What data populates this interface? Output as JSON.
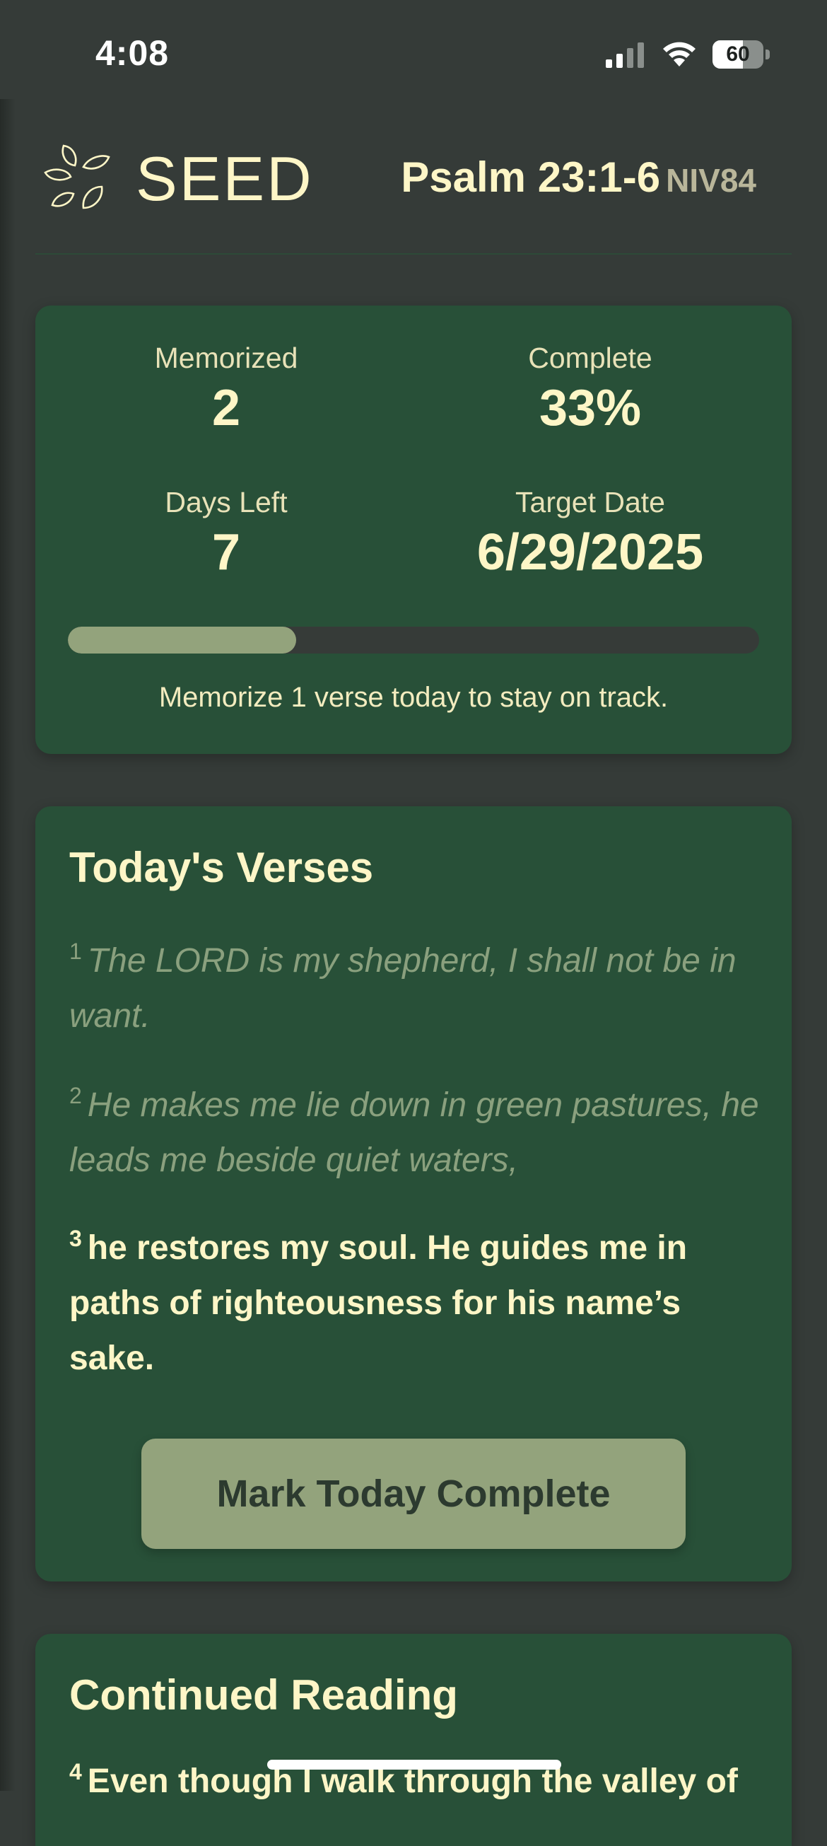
{
  "status_bar": {
    "time": "4:08",
    "battery_level": "60",
    "battery_fraction": 0.6
  },
  "header": {
    "app_name": "SEED",
    "passage_ref": "Psalm 23:1-6",
    "version": "NIV84"
  },
  "stats": {
    "memorized_label": "Memorized",
    "memorized_value": "2",
    "complete_label": "Complete",
    "complete_value": "33%",
    "days_left_label": "Days Left",
    "days_left_value": "7",
    "target_date_label": "Target Date",
    "target_date_value": "6/29/2025",
    "progress_fraction": 0.33,
    "track_message": "Memorize 1 verse today to stay on track."
  },
  "todays_verses": {
    "heading": "Today's Verses",
    "verses": [
      {
        "number": "1",
        "text": "The LORD is my shepherd, I shall not be in want.",
        "state": "memorized"
      },
      {
        "number": "2",
        "text": "He makes me lie down in green pastures, he leads me beside quiet waters,",
        "state": "memorized"
      },
      {
        "number": "3",
        "text": "he restores my soul. He guides me in paths of righteousness for his name’s sake.",
        "state": "current"
      }
    ],
    "button_label": "Mark Today Complete"
  },
  "continued_reading": {
    "heading": "Continued Reading",
    "verses": [
      {
        "number": "4",
        "text": "Even though I walk through the valley of"
      }
    ]
  },
  "colors": {
    "background": "#353b38",
    "card": "#285038",
    "accent": "#93a37c",
    "text": "#fef6c7",
    "muted_verse": "#8aa07e"
  }
}
